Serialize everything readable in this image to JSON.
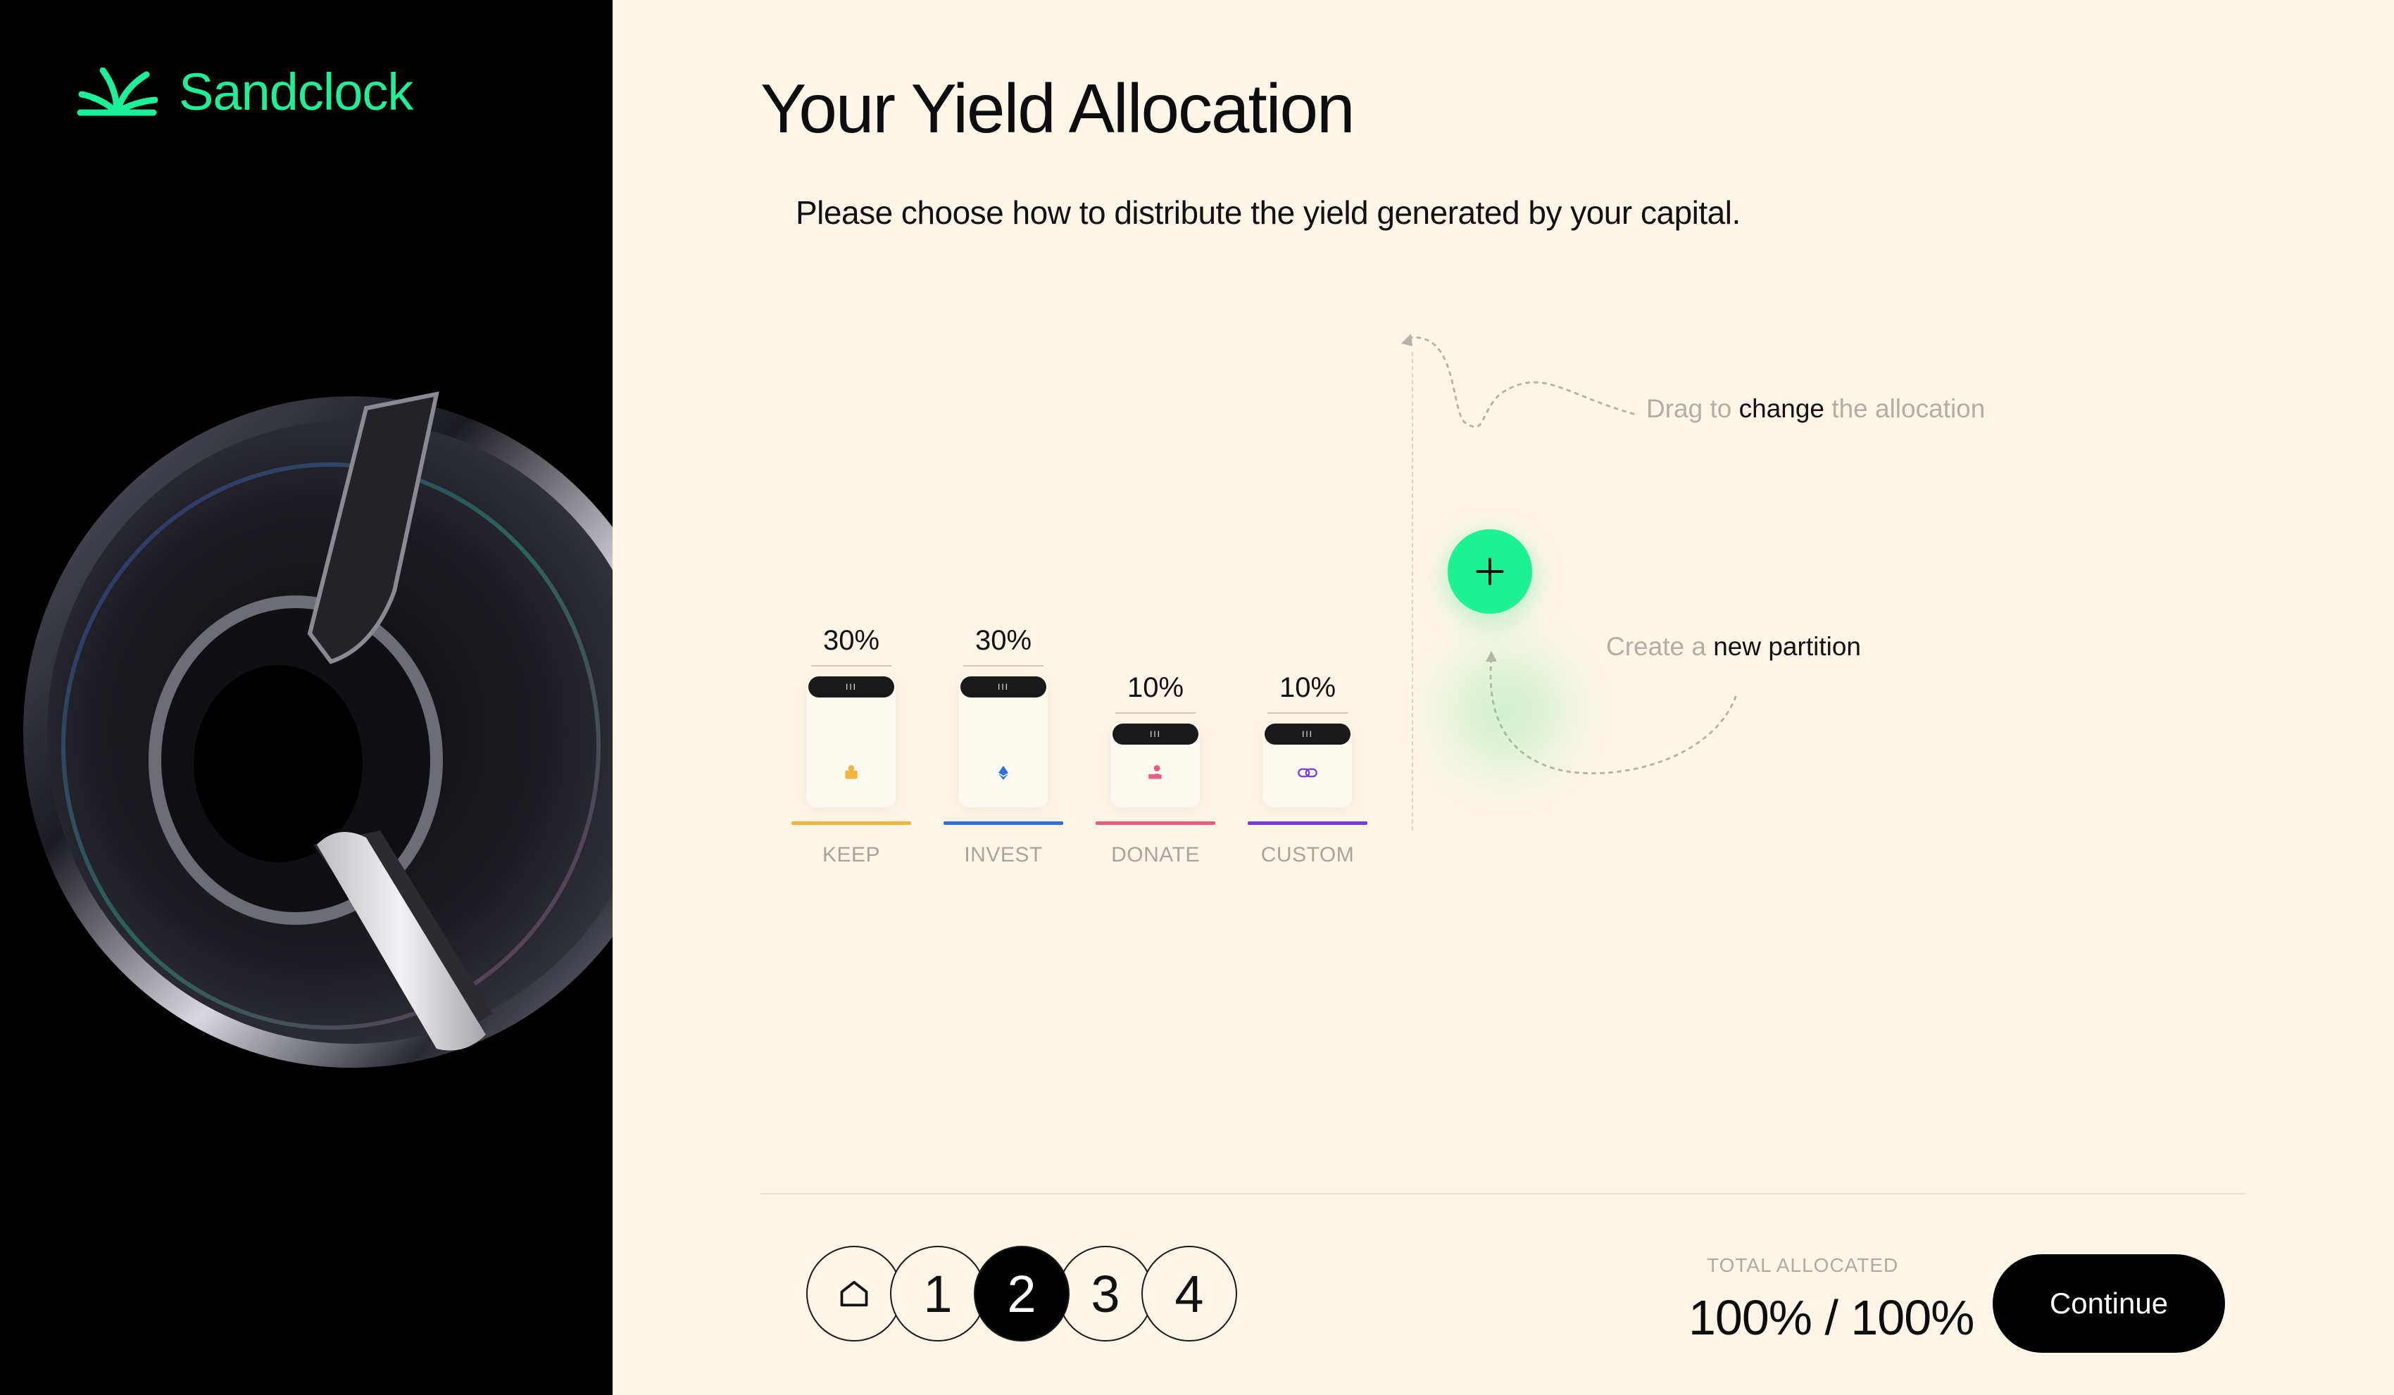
{
  "brand": {
    "name": "Sandclock",
    "accent": "#1cf19a"
  },
  "page": {
    "title": "Your Yield Allocation",
    "subtitle": "Please choose how to distribute the yield generated by your capital."
  },
  "partitions": [
    {
      "label": "KEEP",
      "percent": "30%",
      "icon": "coin-icon",
      "color": "#f5b53c"
    },
    {
      "label": "INVEST",
      "percent": "30%",
      "icon": "ethereum-icon",
      "color": "#2f6fe0"
    },
    {
      "label": "DONATE",
      "percent": "10%",
      "icon": "donate-hand-icon",
      "color": "#ee5a7e"
    },
    {
      "label": "CUSTOM",
      "percent": "10%",
      "icon": "custom-link-icon",
      "color": "#7a3bd9"
    }
  ],
  "hints": {
    "drag": {
      "pre": "Drag to ",
      "emphasis": "change",
      "post": " the allocation"
    },
    "create": {
      "pre": "Create a ",
      "emphasis": "new partition"
    }
  },
  "stepper": {
    "home_icon": "home-icon",
    "steps": [
      "1",
      "2",
      "3",
      "4"
    ],
    "active_step": "2"
  },
  "total": {
    "label": "TOTAL  ALLOCATED",
    "value": "100% / 100%"
  },
  "actions": {
    "continue_label": "Continue"
  },
  "colors": {
    "background": "#fdf5e6",
    "panel": "#000000",
    "add_button": "#1bf291"
  }
}
